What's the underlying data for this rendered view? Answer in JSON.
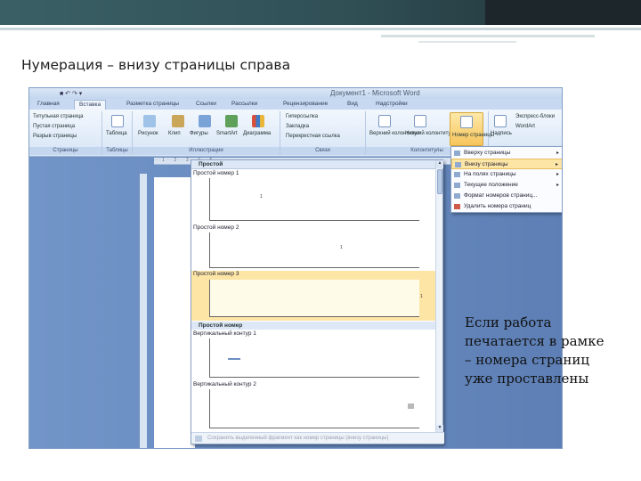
{
  "slide": {
    "title": "Нумерация – внизу страницы справа",
    "caption_lines": [
      "Если работа",
      "печатается в рамке",
      "– номера страниц",
      "уже проставлены"
    ]
  },
  "word": {
    "title": "Документ1 - Microsoft Word",
    "tabs": [
      "Главная",
      "Вставка",
      "Разметка страницы",
      "Ссылки",
      "Рассылки",
      "Рецензирование",
      "Вид",
      "Надстройки"
    ],
    "active_tab": "Вставка",
    "ribbon": {
      "pages_group": {
        "label": "Страницы",
        "items": [
          "Титульная страница",
          "Пустая страница",
          "Разрыв страницы"
        ]
      },
      "tables_group": {
        "label": "Таблицы",
        "button": "Таблица"
      },
      "illustrations_group": {
        "label": "Иллюстрации",
        "buttons": [
          "Рисунок",
          "Клип",
          "Фигуры",
          "SmartArt",
          "Диаграмма"
        ]
      },
      "links_group": {
        "label": "Связи",
        "items": [
          "Гиперссылка",
          "Закладка",
          "Перекрестная ссылка"
        ]
      },
      "headers_group": {
        "label": "Колонтитулы",
        "buttons": [
          "Верхний колонтитул",
          "Нижний колонтитул",
          "Номер страницы"
        ]
      },
      "text_group": {
        "buttons": [
          "Надпись",
          "Экспресс-блоки",
          "WordArt"
        ]
      }
    },
    "gallery": {
      "header": "Простой",
      "items": [
        "Простой номер 1",
        "Простой номер 2",
        "Простой номер 3"
      ],
      "category2": "Простой номер",
      "items2": [
        "Вертикальный контур 1",
        "Вертикальный контур 2"
      ],
      "footer": "Сохранить выделенный фрагмент как номер страницы (внизу страницы)"
    },
    "submenu": {
      "items": [
        "Вверху страницы",
        "Внизу страницы",
        "На полях страницы",
        "Текущее положение",
        "Формат номеров страниц...",
        "Удалить номера страниц"
      ],
      "highlighted": "Внизу страницы"
    }
  }
}
